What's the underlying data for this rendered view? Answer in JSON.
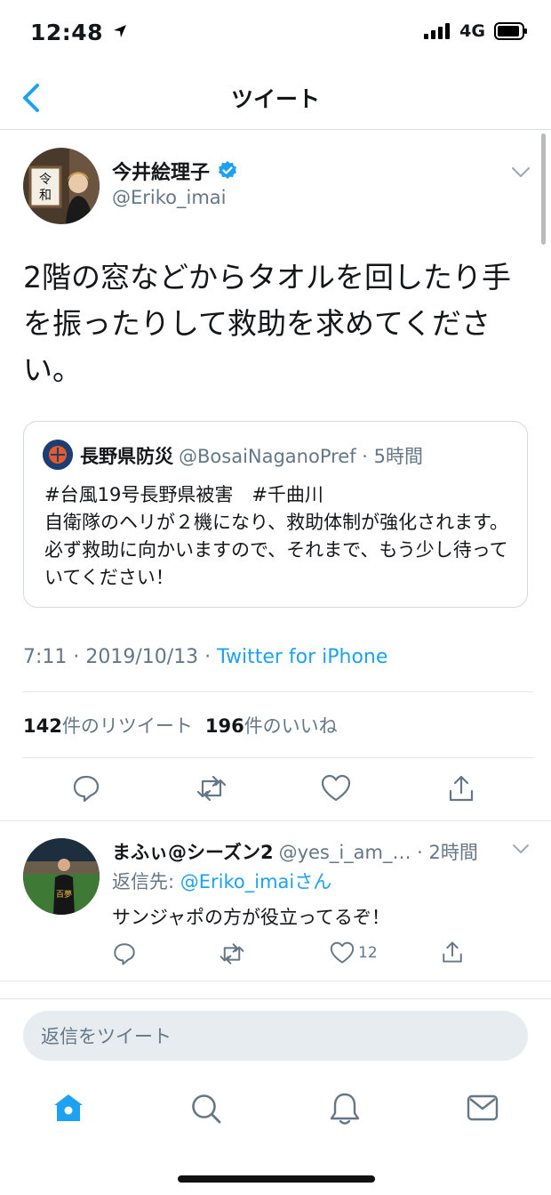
{
  "status_bar": {
    "time": "12:48",
    "network": "4G"
  },
  "nav": {
    "title": "ツイート"
  },
  "tweet": {
    "author_name": "今井絵理子",
    "author_handle": "@Eriko_imai",
    "text": "2階の窓などからタオルを回したり手を振ったりして救助を求めてください。",
    "quote": {
      "name": "長野県防災",
      "handle_time": "@BosaiNaganoPref · 5時間",
      "line1": "#台風19号長野県被害　#千曲川",
      "line2": "自衛隊のヘリが２機になり、救助体制が強化されます。必ず救助に向かいますので、それまで、もう少し待っていてください！"
    },
    "timestamp": "7:11 · 2019/10/13 · ",
    "source": "Twitter for iPhone",
    "retweets_count": "142",
    "retweets_label": "件のリツイート",
    "likes_count": "196",
    "likes_label": "件のいいね"
  },
  "reply": {
    "name": "まふぃ@シーズン2",
    "meta": "@yes_i_am_… · 2時間",
    "reply_to_prefix": "返信先: ",
    "reply_to_mention": "@Eriko_imaiさん",
    "text": "サンジャポの方が役立ってるぞ！",
    "like_count": "12"
  },
  "compose": {
    "placeholder": "返信をツイート"
  },
  "icons": {
    "back": "chevron-left-icon",
    "caret": "chevron-down-icon",
    "verified": "verified-badge-icon",
    "reply": "comment-icon",
    "retweet": "retweet-icon",
    "like": "heart-icon",
    "share": "share-icon",
    "home": "home-icon",
    "search": "search-icon",
    "notifications": "bell-icon",
    "messages": "mail-icon"
  },
  "colors": {
    "accent": "#1da1f2",
    "secondary_text": "#657786",
    "divider": "#e1e8ed"
  }
}
